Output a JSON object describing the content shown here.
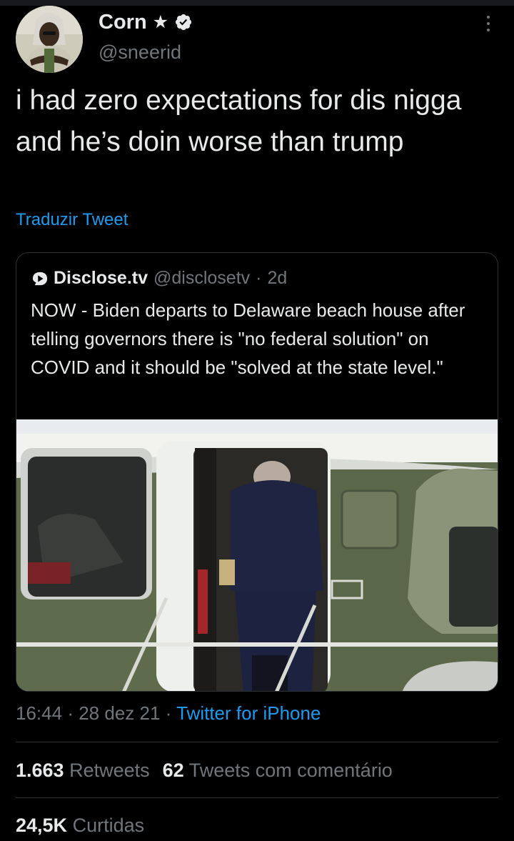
{
  "author": {
    "name": "Corn",
    "handle": "@sneerid"
  },
  "tweet": {
    "text": "i had zero expectations for dis nigga and he’s doin worse than trump",
    "translate_label": "Traduzir Tweet"
  },
  "quoted": {
    "name": "Disclose.tv",
    "handle": "@disclosetv",
    "separator": "·",
    "age": "2d",
    "text": "NOW - Biden departs to Delaware beach house after telling governors there is \"no federal solution\" on COVID and it should be \"solved at the state level.\"",
    "media_icon": "photo-helicopter-boarding"
  },
  "meta": {
    "time": "16:44",
    "sep1": "·",
    "date": "28 dez 21",
    "sep2": "·",
    "source": "Twitter for iPhone"
  },
  "stats": {
    "retweets_count": "1.663",
    "retweets_label": "Retweets",
    "quotes_count": "62",
    "quotes_label": "Tweets com comentário",
    "likes_count": "24,5K",
    "likes_label": "Curtidas"
  },
  "colors": {
    "background": "#000000",
    "text": "#e7e9ea",
    "muted": "#71767b",
    "link": "#1d9bf0",
    "border": "#2f3336"
  },
  "icons": [
    "star-icon",
    "verified-badge-icon",
    "more-options-icon",
    "disclose-logo-icon"
  ]
}
